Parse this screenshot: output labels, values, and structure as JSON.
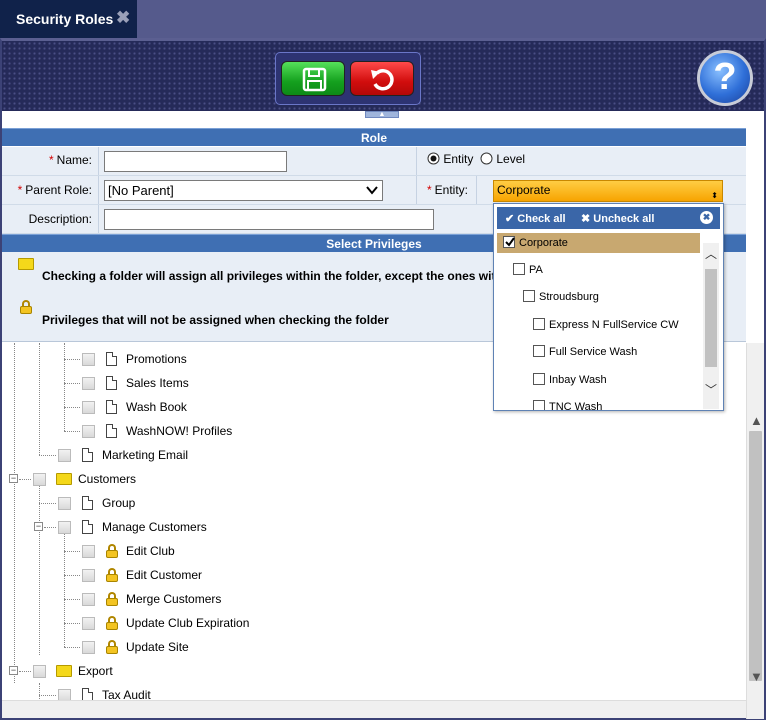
{
  "tab": {
    "title": "Security Roles",
    "close_glyph": "✖"
  },
  "toolbar": {
    "save_icon": "save-icon",
    "undo_icon": "undo-icon",
    "help_glyph": "?"
  },
  "role": {
    "header": "Role",
    "name_label": "Name:",
    "name_value": "",
    "parent_label": "Parent Role:",
    "parent_value": "[No Parent]",
    "description_label": "Description:",
    "description_value": "",
    "mode_entity": "Entity",
    "mode_level": "Level",
    "entity_label": "Entity:",
    "entity_value": "Corporate",
    "required_marker": "*"
  },
  "privileges": {
    "header": "Select Privileges",
    "info_folder": "Checking a folder will assign all privileges within the folder, except the ones wit",
    "info_lock": "Privileges that will not be assigned when checking the folder"
  },
  "tree": [
    {
      "label": "Promotions"
    },
    {
      "label": "Sales Items"
    },
    {
      "label": "Wash Book"
    },
    {
      "label": "WashNOW! Profiles"
    },
    {
      "label": "Marketing Email"
    },
    {
      "label": "Customers"
    },
    {
      "label": "Group"
    },
    {
      "label": "Manage Customers"
    },
    {
      "label": "Edit Club"
    },
    {
      "label": "Edit Customer"
    },
    {
      "label": "Merge Customers"
    },
    {
      "label": "Update Club Expiration"
    },
    {
      "label": "Update Site"
    },
    {
      "label": "Export"
    },
    {
      "label": "Tax Audit"
    }
  ],
  "entity_dropdown": {
    "check_all": "Check all",
    "uncheck_all": "Uncheck all",
    "items": [
      {
        "label": "Corporate",
        "checked": true
      },
      {
        "label": "PA",
        "checked": false
      },
      {
        "label": "Stroudsburg",
        "checked": false
      },
      {
        "label": "Express N FullService CW",
        "checked": false
      },
      {
        "label": "Full Service Wash",
        "checked": false
      },
      {
        "label": "Inbay Wash",
        "checked": false
      },
      {
        "label": "TNC Wash",
        "checked": false
      }
    ]
  },
  "colors": {
    "accent": "#3f6fb3",
    "tab_bg": "#10224a",
    "selected_item": "#c8a870"
  }
}
